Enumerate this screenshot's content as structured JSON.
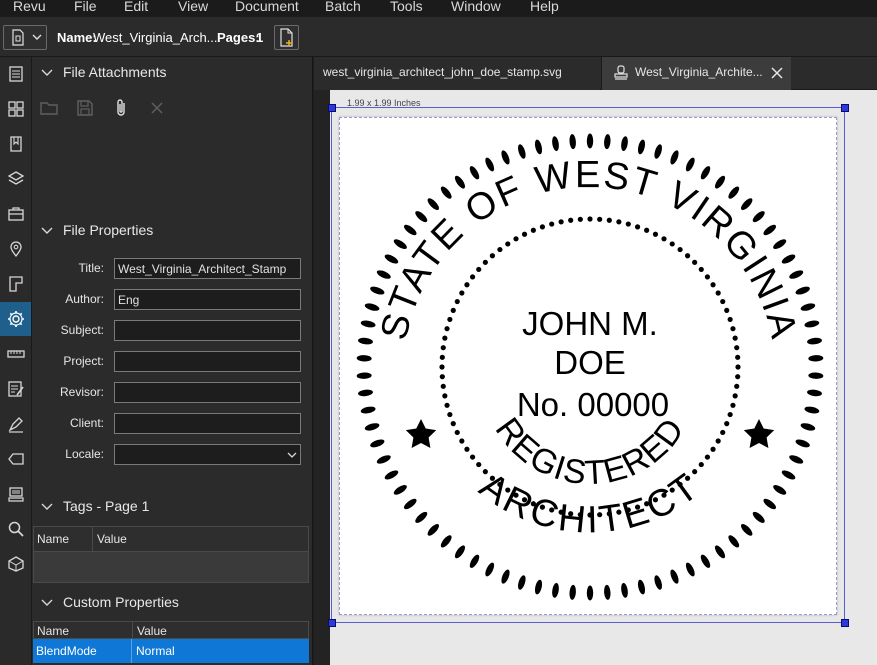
{
  "menubar": {
    "items": [
      "Revu",
      "File",
      "Edit",
      "View",
      "Document",
      "Batch",
      "Tools",
      "Window",
      "Help"
    ]
  },
  "toolbar": {
    "name_label": "Name:",
    "name_value": "West_Virginia_Arch...",
    "pages_label": "Pages:",
    "pages_value": "1"
  },
  "rail": {
    "icons": [
      "thumbnails-icon",
      "grid-icon",
      "bookmarks-icon",
      "layers-icon",
      "toolchest-icon",
      "places-icon",
      "measure-icon",
      "properties-icon",
      "ruler-icon",
      "markups-icon",
      "signature-icon",
      "tag-icon",
      "stamp-icon",
      "search-icon",
      "3d-icon"
    ],
    "active": "properties-icon"
  },
  "file_attachments": {
    "title": "File Attachments"
  },
  "file_properties": {
    "title": "File Properties",
    "fields": [
      {
        "label": "Title:",
        "value": "West_Virginia_Architect_Stamp"
      },
      {
        "label": "Author:",
        "value": "Eng"
      },
      {
        "label": "Subject:",
        "value": ""
      },
      {
        "label": "Project:",
        "value": ""
      },
      {
        "label": "Revisor:",
        "value": ""
      },
      {
        "label": "Client:",
        "value": ""
      }
    ],
    "locale_label": "Locale:",
    "locale_value": ""
  },
  "tags": {
    "title": "Tags - Page 1",
    "col_name": "Name",
    "col_value": "Value"
  },
  "custom_properties": {
    "title": "Custom Properties",
    "col_name": "Name",
    "col_value": "Value",
    "rows": [
      {
        "name": "BlendMode",
        "value": "Normal"
      }
    ]
  },
  "tabs": [
    {
      "label": "west_virginia_architect_john_doe_stamp.svg"
    },
    {
      "label": "West_Virginia_Archite..."
    }
  ],
  "canvas": {
    "dimension_label": "1.99 x 1.99 Inches"
  },
  "stamp": {
    "top_arc": "STATE OF WEST VIRGINIA",
    "line1": "JOHN M.",
    "line2": "DOE",
    "line3": "No. 00000",
    "inner_arc": "REGISTERED",
    "bottom_arc": "ARCHITECT"
  }
}
